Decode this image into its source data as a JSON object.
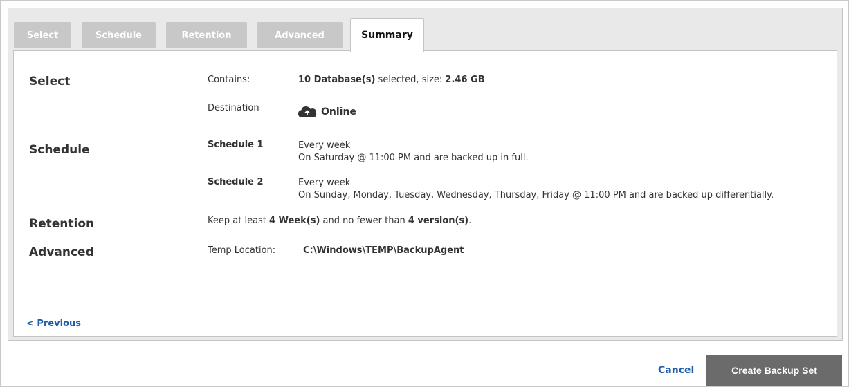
{
  "tabs": [
    {
      "label": "Select"
    },
    {
      "label": "Schedule"
    },
    {
      "label": "Retention"
    },
    {
      "label": "Advanced"
    },
    {
      "label": "Summary",
      "active": true
    }
  ],
  "summary": {
    "select": {
      "title": "Select",
      "contains_label": "Contains:",
      "contains_count": "10 Database(s)",
      "contains_mid": " selected, size: ",
      "contains_size": "2.46 GB",
      "destination_label": "Destination",
      "destination_icon": "cloud-icon",
      "destination_value": "Online"
    },
    "schedule": {
      "title": "Schedule",
      "items": [
        {
          "name": "Schedule 1",
          "line1": "Every week",
          "line2": "On Saturday @ 11:00 PM and are backed up in full."
        },
        {
          "name": "Schedule 2",
          "line1": "Every week",
          "line2": "On Sunday, Monday, Tuesday, Wednesday, Thursday, Friday @ 11:00 PM and are backed up differentially."
        }
      ]
    },
    "retention": {
      "title": "Retention",
      "prefix": "Keep at least ",
      "weeks": "4 Week(s)",
      "mid": " and no fewer than ",
      "versions": "4 version(s)",
      "suffix": "."
    },
    "advanced": {
      "title": "Advanced",
      "temp_label": "Temp Location:",
      "temp_value": "C:\\Windows\\TEMP\\BackupAgent"
    }
  },
  "nav": {
    "previous_label": "< Previous"
  },
  "footer": {
    "cancel_label": "Cancel",
    "create_label": "Create Backup Set"
  },
  "colors": {
    "link": "#1f5fa8",
    "button": "#6b6b6b",
    "tab_inactive": "#c8c8c8"
  }
}
